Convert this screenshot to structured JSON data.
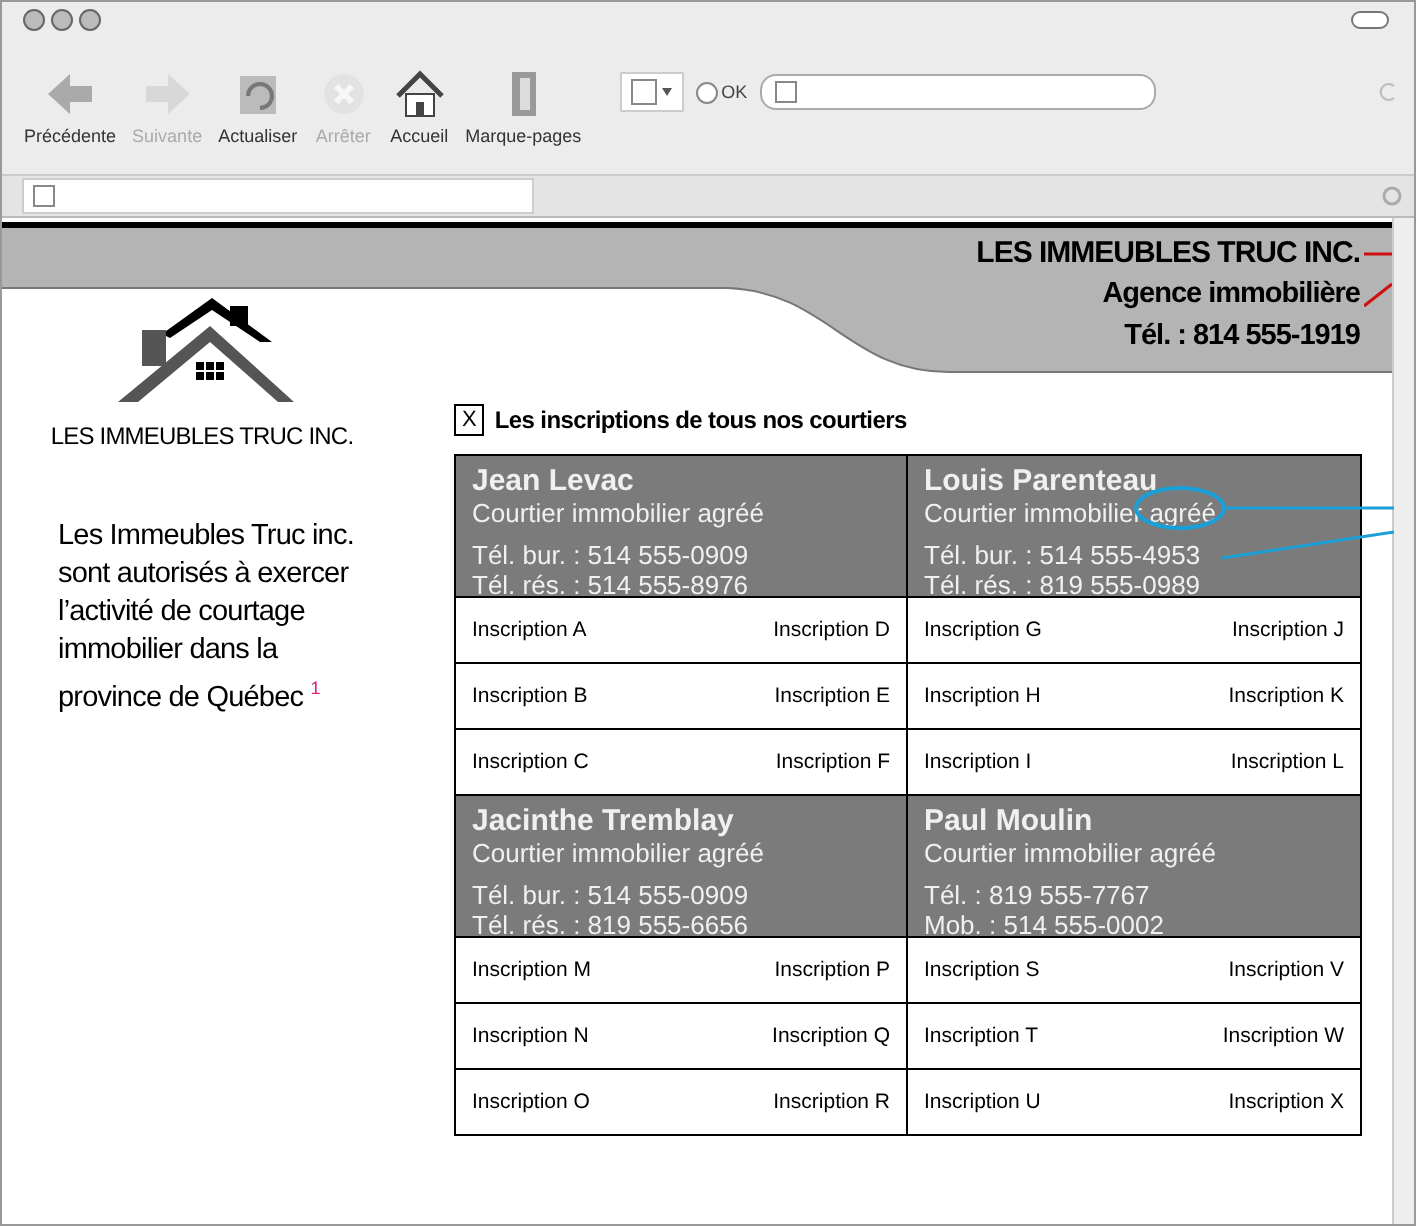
{
  "toolbar": [
    {
      "kind": "back",
      "label": "Précédente",
      "disabled": false
    },
    {
      "kind": "forward",
      "label": "Suivante",
      "disabled": true
    },
    {
      "kind": "refresh",
      "label": "Actualiser",
      "disabled": false
    },
    {
      "kind": "stop",
      "label": "Arrêter",
      "disabled": true
    },
    {
      "kind": "home",
      "label": "Accueil",
      "disabled": false
    },
    {
      "kind": "bookmarks",
      "label": "Marque-pages",
      "disabled": false
    }
  ],
  "search": {
    "button": "OK",
    "selected": false
  },
  "header": {
    "company": "LES IMMEUBLES TRUC INC.",
    "agency": "Agence immobilière",
    "phone": "Tél. : 814 555-1919"
  },
  "logo": {
    "text": "LES IMMEUBLES TRUC INC."
  },
  "intro": "Les Immeubles Truc inc. sont autorisés à exercer l’activité de courtage immobilier dans la province de Québec $^{1}$",
  "listings": {
    "checkbox": "X",
    "title": "Les inscriptions de tous nos courtiers",
    "brokers": [
      {
        "name": "Jean Levac",
        "role": "Courtier immobilier agréé",
        "phone_1": "Tél. bur. : 514 555-0909",
        "phone_2": "Tél. rés. : 514 555-8976",
        "rows": [
          [
            "Inscription A",
            "Inscription D"
          ],
          [
            "Inscription B",
            "Inscription E"
          ],
          [
            "Inscription C",
            "Inscription F"
          ]
        ]
      },
      {
        "name": "Louis Parenteau",
        "role": "Courtier immobilier agréé",
        "phone_1": "Tél. bur. : 514 555-4953",
        "phone_2": "Tél. rés. : 819 555-0989",
        "rows": [
          [
            "Inscription G",
            "Inscription J"
          ],
          [
            "Inscription H",
            "Inscription K"
          ],
          [
            "Inscription I",
            "Inscription L"
          ]
        ]
      },
      {
        "name": "Jacinthe Tremblay",
        "role": "Courtier immobilier agréé",
        "phone_1": "Tél. bur. : 514 555-0909",
        "phone_2": "Tél. rés. : 819 555-6656",
        "rows": [
          [
            "Inscription M",
            "Inscription P"
          ],
          [
            "Inscription N",
            "Inscription Q"
          ],
          [
            "Inscription O",
            "Inscription R"
          ]
        ]
      },
      {
        "name": "Paul Moulin",
        "role": "Courtier immobilier agréé",
        "phone_1": "Tél. : 819 555-7767",
        "phone_2": "Mob. : 514 555-0002",
        "rows": [
          [
            "Inscription S",
            "Inscription V"
          ],
          [
            "Inscription T",
            "Inscription W"
          ],
          [
            "Inscription U",
            "Inscription X"
          ]
        ]
      }
    ]
  }
}
